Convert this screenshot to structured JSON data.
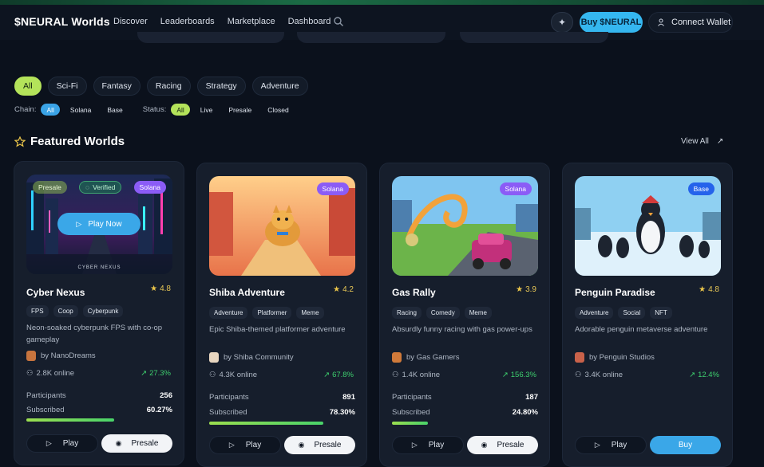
{
  "nav": {
    "brand": "$NEURAL Worlds",
    "links": [
      "Discover",
      "Leaderboards",
      "Marketplace",
      "Dashboard"
    ],
    "buy_label": "Buy $NEURAL",
    "wallet_label": "Connect Wallet"
  },
  "genres": [
    "All",
    "Sci-Fi",
    "Fantasy",
    "Racing",
    "Strategy",
    "Adventure"
  ],
  "filters": {
    "chain_label": "Chain:",
    "chain_options": [
      "All",
      "Solana",
      "Base"
    ],
    "status_label": "Status:",
    "status_options": [
      "All",
      "Live",
      "Presale",
      "Closed"
    ]
  },
  "featured": {
    "title": "Featured Worlds",
    "view_all": "View All"
  },
  "cards": [
    {
      "title": "Cyber Nexus",
      "rating": "4.8",
      "tags": [
        "FPS",
        "Coop",
        "Cyberpunk"
      ],
      "description": "Neon-soaked cyberpunk FPS with co-op gameplay",
      "creator": "by NanoDreams",
      "online": "2.8K online",
      "growth": "27.3%",
      "participants_label": "Participants",
      "participants": "256",
      "subscribed_label": "Subscribed",
      "subscribed": "60.27%",
      "progress": 0.6027,
      "chain": "Solana",
      "status": "Presale",
      "verified": "Verified",
      "play_now": "Play Now",
      "caption": "CYBER NEXUS",
      "play_label": "Play",
      "action_label": "Presale"
    },
    {
      "title": "Shiba Adventure",
      "rating": "4.2",
      "tags": [
        "Adventure",
        "Platformer",
        "Meme"
      ],
      "description": "Epic Shiba-themed platformer adventure",
      "creator": "by Shiba Community",
      "online": "4.3K online",
      "growth": "67.8%",
      "participants_label": "Participants",
      "participants": "891",
      "subscribed_label": "Subscribed",
      "subscribed": "78.30%",
      "progress": 0.783,
      "chain": "Solana",
      "play_label": "Play",
      "action_label": "Presale"
    },
    {
      "title": "Gas Rally",
      "rating": "3.9",
      "tags": [
        "Racing",
        "Comedy",
        "Meme"
      ],
      "description": "Absurdly funny racing with gas power-ups",
      "creator": "by Gas Gamers",
      "online": "1.4K online",
      "growth": "156.3%",
      "participants_label": "Participants",
      "participants": "187",
      "subscribed_label": "Subscribed",
      "subscribed": "24.80%",
      "progress": 0.248,
      "chain": "Solana",
      "play_label": "Play",
      "action_label": "Presale"
    },
    {
      "title": "Penguin Paradise",
      "rating": "4.8",
      "tags": [
        "Adventure",
        "Social",
        "NFT"
      ],
      "description": "Adorable penguin metaverse adventure",
      "creator": "by Penguin Studios",
      "online": "3.4K online",
      "growth": "12.4%",
      "chain": "Base",
      "play_label": "Play",
      "action_label": "Buy"
    }
  ],
  "colors": {
    "accent_green": "#b4e35a",
    "accent_blue": "#3aa7e8",
    "solana_purple": "#8b5cf6",
    "base_blue": "#2563eb",
    "growth_green": "#3ecf6e",
    "rating_gold": "#e9c44a"
  }
}
